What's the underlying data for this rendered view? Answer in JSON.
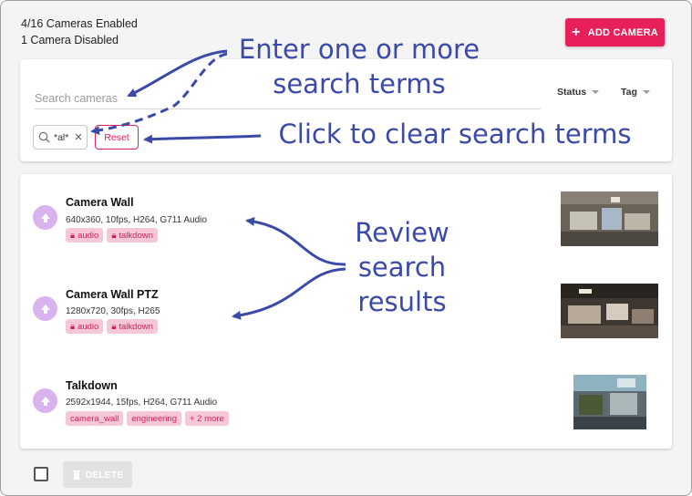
{
  "header": {
    "enabled_text": "4/16 Cameras Enabled",
    "disabled_text": "1 Camera Disabled",
    "add_button_label": "ADD CAMERA"
  },
  "search": {
    "placeholder": "Search cameras",
    "value": "",
    "filters": [
      {
        "label": "Status"
      },
      {
        "label": "Tag"
      }
    ],
    "active_term": "*al*",
    "reset_label": "Reset"
  },
  "cameras": [
    {
      "name": "Camera Wall",
      "spec": "640x360, 10fps, H264, G711 Audio",
      "tags": [
        {
          "label": "audio",
          "locked": true
        },
        {
          "label": "talkdown",
          "locked": true
        }
      ]
    },
    {
      "name": "Camera Wall PTZ",
      "spec": "1280x720, 30fps, H265",
      "tags": [
        {
          "label": "audio",
          "locked": true
        },
        {
          "label": "talkdown",
          "locked": true
        }
      ]
    },
    {
      "name": "Talkdown",
      "spec": "2592x1944, 15fps, H264, G711 Audio",
      "tags": [
        {
          "label": "camera_wall",
          "locked": false
        },
        {
          "label": "engineering",
          "locked": false
        },
        {
          "label": "+ 2 more",
          "locked": false
        }
      ]
    }
  ],
  "footer": {
    "delete_label": "DELETE"
  },
  "callouts": {
    "search_line1": "Enter one or more",
    "search_line2": "search terms",
    "reset": "Click to clear search terms",
    "results_line1": "Review",
    "results_line2": "search",
    "results_line3": "results"
  },
  "colors": {
    "accent": "#e8205a",
    "callout": "#3b4aa8",
    "tag_bg": "#f6c8d6",
    "avatar": "#d9b3ee"
  }
}
